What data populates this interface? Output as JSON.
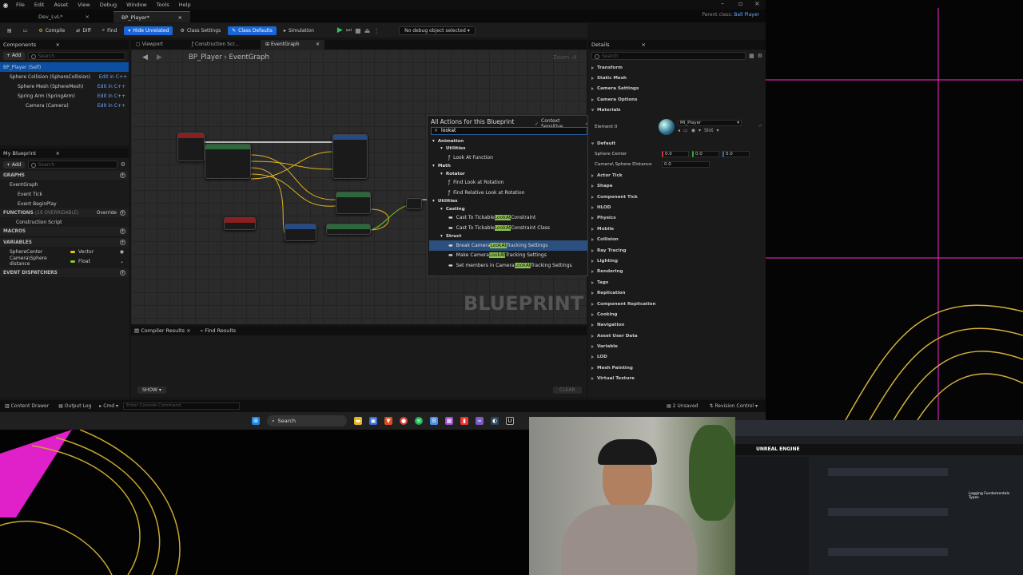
{
  "menu": {
    "items": [
      "File",
      "Edit",
      "Asset",
      "View",
      "Debug",
      "Window",
      "Tools",
      "Help"
    ]
  },
  "tabs": [
    {
      "label": "Dev_LvL*"
    },
    {
      "label": "BP_Player*"
    }
  ],
  "parent_class": {
    "label": "Parent class:",
    "value": "Ball Player"
  },
  "toolbar": {
    "compile": "Compile",
    "diff": "Diff",
    "find": "Find",
    "hide_unrelated": "Hide Unrelated",
    "class_settings": "Class Settings",
    "class_defaults": "Class Defaults",
    "simulation": "Simulation",
    "debug_select": "No debug object selected"
  },
  "components": {
    "title": "Components",
    "add": "+ Add",
    "search_placeholder": "Search",
    "items": [
      {
        "label": "BP_Player (Self)",
        "link": ""
      },
      {
        "label": "Sphere Collision (SphereCollision)",
        "link": "Edit in C++"
      },
      {
        "label": "Sphere Mesh (SphereMesh)",
        "link": "Edit in C++"
      },
      {
        "label": "Spring Arm (SpringArm)",
        "link": "Edit in C++"
      },
      {
        "label": "Camera (Camera)",
        "link": "Edit in C++"
      }
    ]
  },
  "my_blueprint": {
    "title": "My Blueprint",
    "add": "+ Add",
    "search_placeholder": "Search",
    "graphs": "GRAPHS",
    "event_graph": "EventGraph",
    "event_tick": "Event Tick",
    "begin_play": "Event BeginPlay",
    "functions": "FUNCTIONS",
    "functions_count": "(19 OVERRIDABLE)",
    "override": "Override",
    "construction_script": "Construction Script",
    "macros": "MACROS",
    "variables": "VARIABLES",
    "vars": [
      {
        "name": "SphereCenter",
        "type": "Vector",
        "color": "#f2c400"
      },
      {
        "name": "Camera\\Sphere distance",
        "type": "Float",
        "color": "#7ed321"
      }
    ],
    "event_dispatchers": "EVENT DISPATCHERS"
  },
  "graph": {
    "tabs": [
      {
        "label": "Viewport"
      },
      {
        "label": "Construction Scr..."
      },
      {
        "label": "EventGraph"
      }
    ],
    "breadcrumb": [
      "BP_Player",
      "EventGraph"
    ],
    "zoom": "Zoom -4",
    "watermark": "BLUEPRINT"
  },
  "palette": {
    "title": "All Actions for this Blueprint",
    "context": "Context Sensitive",
    "search": "lookat",
    "rows": [
      {
        "kind": "cat",
        "indent": 0,
        "pre": "Animation",
        "hl": "",
        "post": ""
      },
      {
        "kind": "cat",
        "indent": 1,
        "pre": "Utilities",
        "hl": "",
        "post": ""
      },
      {
        "kind": "fn",
        "indent": 2,
        "pre": "Look At Function",
        "hl": "",
        "post": ""
      },
      {
        "kind": "cat",
        "indent": 0,
        "pre": "Math",
        "hl": "",
        "post": ""
      },
      {
        "kind": "cat",
        "indent": 1,
        "pre": "Rotator",
        "hl": "",
        "post": ""
      },
      {
        "kind": "fn",
        "indent": 2,
        "pre": "Find Look at Rotation",
        "hl": "",
        "post": ""
      },
      {
        "kind": "fn",
        "indent": 2,
        "pre": "Find Relative Look at Rotation",
        "hl": "",
        "post": ""
      },
      {
        "kind": "cat",
        "indent": 0,
        "pre": "Utilities",
        "hl": "",
        "post": ""
      },
      {
        "kind": "cat",
        "indent": 1,
        "pre": "Casting",
        "hl": "",
        "post": ""
      },
      {
        "kind": "fn",
        "indent": 2,
        "pre": "Cast To Tickable",
        "hl": "LookAt",
        "post": "Constraint"
      },
      {
        "kind": "fn",
        "indent": 2,
        "pre": "Cast To Tickable",
        "hl": "LookAt",
        "post": "Constraint Class"
      },
      {
        "kind": "cat",
        "indent": 1,
        "pre": "Struct",
        "hl": "",
        "post": ""
      },
      {
        "kind": "fn",
        "indent": 2,
        "pre": "Break Camera",
        "hl": "LookAt",
        "post": "Tracking Settings"
      },
      {
        "kind": "fn",
        "indent": 2,
        "pre": "Make Camera",
        "hl": "LookAt",
        "post": "Tracking Settings"
      },
      {
        "kind": "fn",
        "indent": 2,
        "pre": "Set members in Camera",
        "hl": "LookAt",
        "post": "Tracking Settings"
      }
    ]
  },
  "compiler": {
    "tab1": "Compiler Results",
    "tab2": "Find Results",
    "show": "SHOW",
    "clear": "CLEAR"
  },
  "details": {
    "title": "Details",
    "search_placeholder": "Search",
    "element0": "Element 0",
    "material": "MI_Player",
    "slot": "Slot",
    "sphere_center": {
      "label": "Sphere Center",
      "x": "0.0",
      "y": "0.0",
      "z": "0.0"
    },
    "sphere_distance": {
      "label": "Camera\\ Sphere Distance",
      "value": "0.0"
    },
    "sections_top": [
      "Transform",
      "Static Mesh",
      "Camera Settings",
      "Camera Options",
      "Materials"
    ],
    "sections_bottom": [
      "Actor Tick",
      "Shape",
      "Component Tick",
      "HLOD",
      "Physics",
      "Mobile",
      "Collision",
      "Ray Tracing",
      "Lighting",
      "Rendering",
      "Tags",
      "Replication",
      "Component Replication",
      "Cooking",
      "Navigation",
      "Asset User Data",
      "Variable",
      "LOD",
      "Mesh Painting",
      "Virtual Texture"
    ],
    "default": "Default"
  },
  "statusbar": {
    "content_drawer": "Content Drawer",
    "output_log": "Output Log",
    "cmd": "Cmd",
    "console_placeholder": "Enter Console Command",
    "unsaved": "2 Unsaved",
    "revision": "Revision Control"
  },
  "taskbar": {
    "search": "Search"
  },
  "browser": {
    "logo": "UNREAL ENGINE",
    "section": "Logging Fundamentals Types"
  }
}
